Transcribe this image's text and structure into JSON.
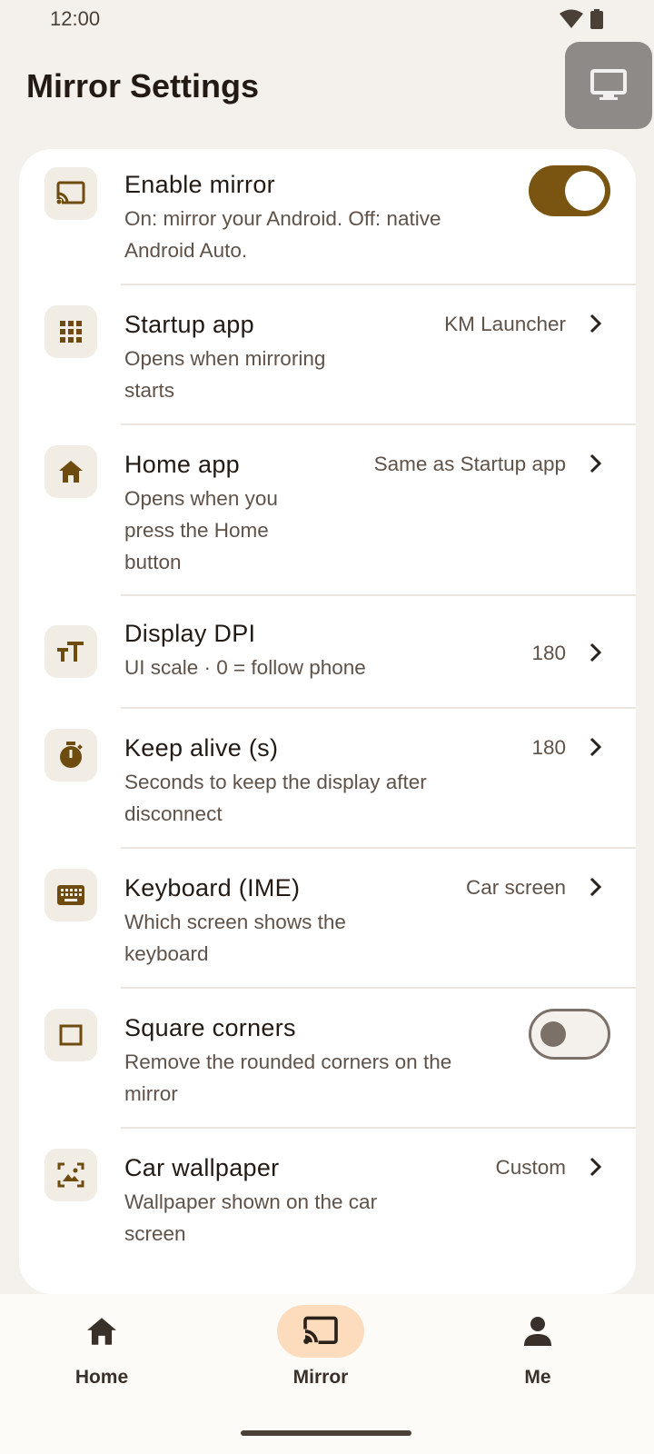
{
  "status": {
    "time": "12:00"
  },
  "header": {
    "title": "Mirror Settings"
  },
  "settings": [
    {
      "title": "Enable mirror",
      "subtitle": "On: mirror your Android. Off: native Android Auto.",
      "control": "toggle",
      "toggle_on": true,
      "icon": "cast-icon"
    },
    {
      "title": "Startup app",
      "subtitle": "Opens when mirroring starts",
      "value": "KM Launcher",
      "control": "chevron",
      "icon": "apps-grid-icon"
    },
    {
      "title": "Home app",
      "subtitle": "Opens when you press the Home button",
      "value": "Same as Startup app",
      "control": "chevron",
      "icon": "home-icon"
    },
    {
      "title": "Display DPI",
      "subtitle": "UI scale · 0 = follow phone",
      "value": "180",
      "control": "chevron",
      "icon": "text-size-icon"
    },
    {
      "title": "Keep alive (s)",
      "subtitle": "Seconds to keep the display after disconnect",
      "value": "180",
      "control": "chevron",
      "icon": "timer-icon"
    },
    {
      "title": "Keyboard (IME)",
      "subtitle": "Which screen shows the keyboard",
      "value": "Car screen",
      "control": "chevron",
      "icon": "keyboard-icon"
    },
    {
      "title": "Square corners",
      "subtitle": "Remove the rounded corners on the mirror",
      "control": "toggle",
      "toggle_on": false,
      "icon": "square-icon"
    },
    {
      "title": "Car wallpaper",
      "subtitle": "Wallpaper shown on the car screen",
      "value": "Custom",
      "control": "chevron",
      "icon": "wallpaper-icon"
    }
  ],
  "nav": [
    {
      "label": "Home",
      "icon": "home-icon",
      "active": false
    },
    {
      "label": "Mirror",
      "icon": "cast-icon",
      "active": true
    },
    {
      "label": "Me",
      "icon": "person-icon",
      "active": false
    }
  ],
  "colors": {
    "accent": "#7a5512",
    "background": "#f4f1ec",
    "nav_active_pill": "#fcdcbc"
  }
}
